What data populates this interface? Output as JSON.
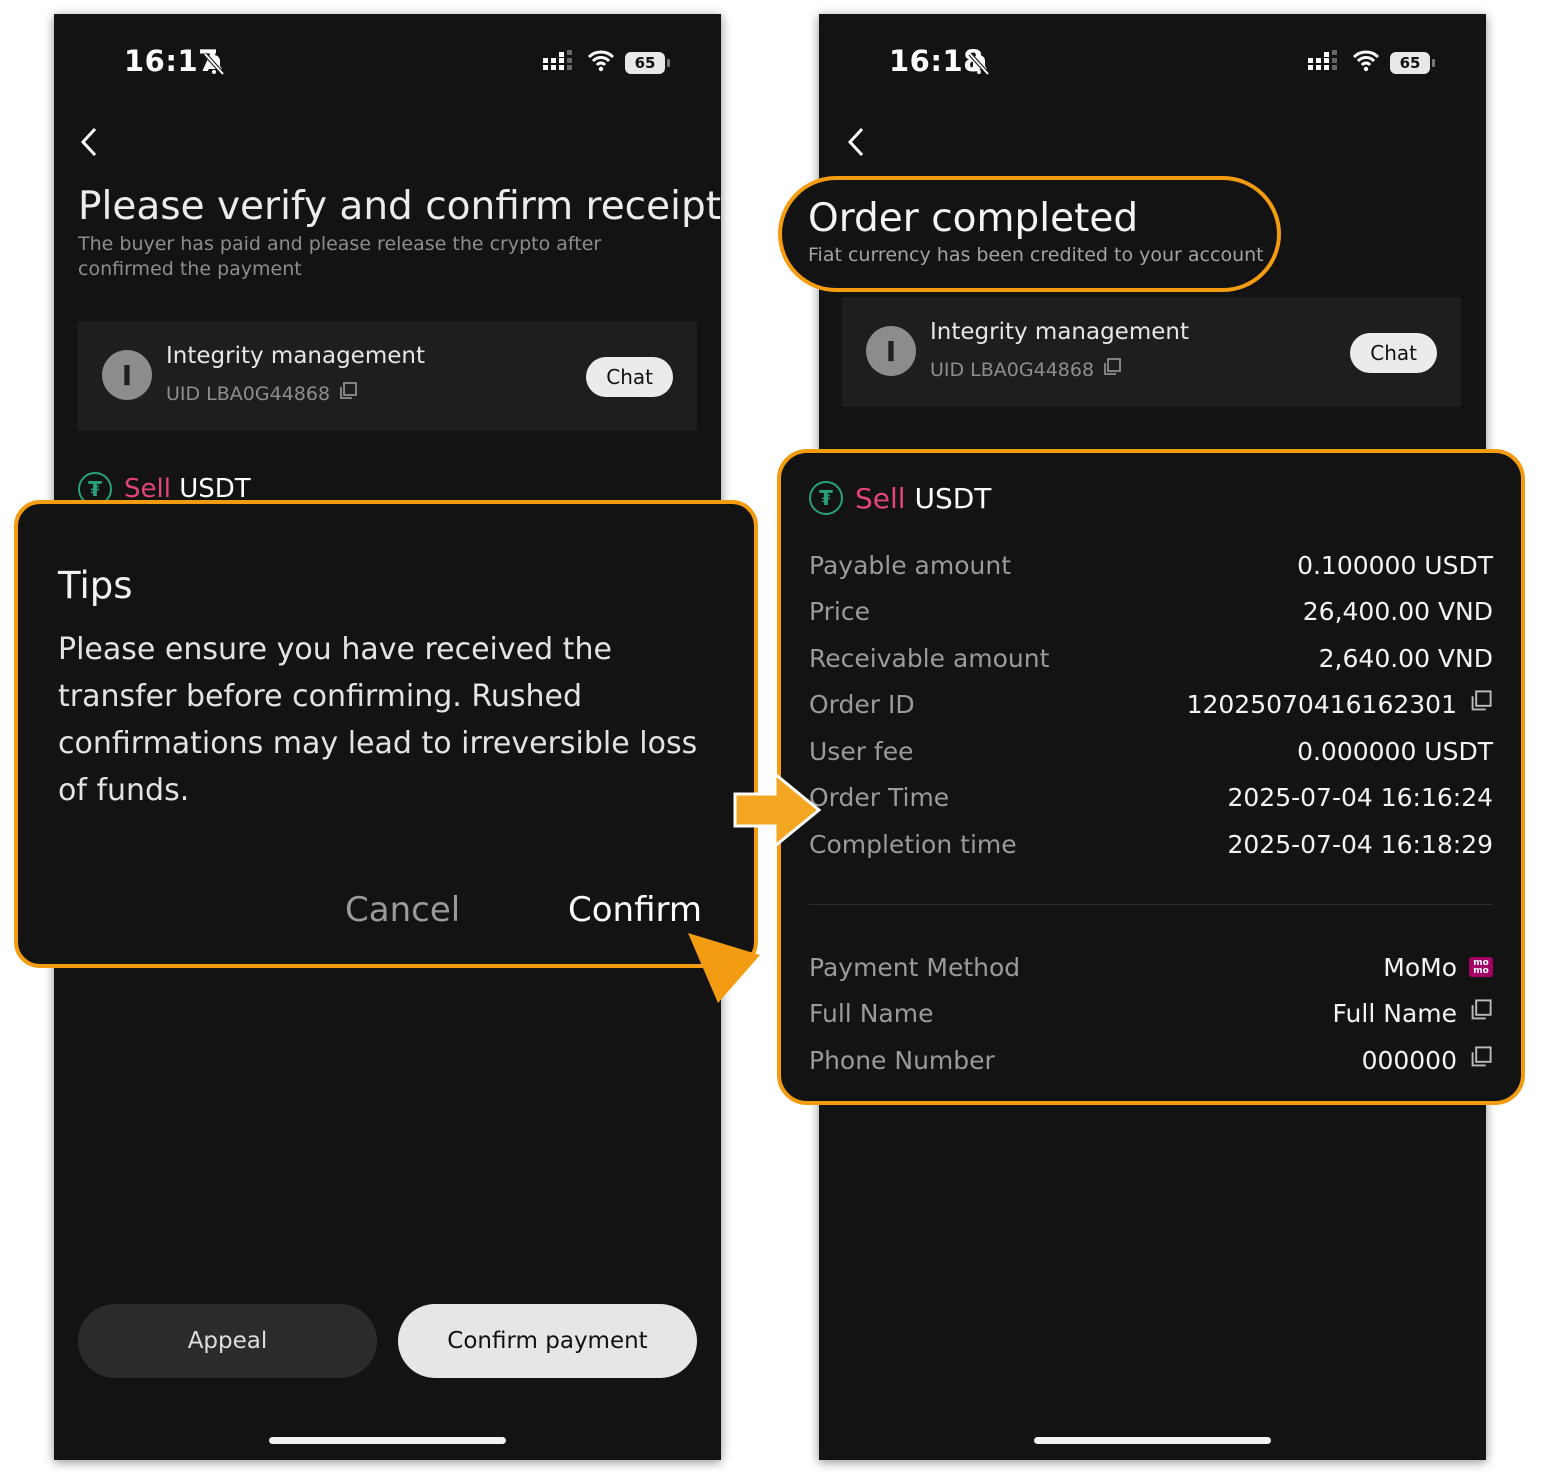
{
  "left_screen": {
    "status": {
      "time": "16:17",
      "battery": "65"
    },
    "title": "Please verify and confirm receipt",
    "subtitle": "The buyer has paid and please release the crypto after confirmed the payment",
    "merchant": {
      "avatar_letter": "I",
      "name": "Integrity management",
      "uid": "UID LBA0G44868",
      "chat_label": "Chat"
    },
    "sell_label": "Sell",
    "asset": "USDT",
    "appeal_label": "Appeal",
    "confirm_payment_label": "Confirm payment"
  },
  "tips_dialog": {
    "title": "Tips",
    "message": "Please ensure you have received the transfer before confirming. Rushed confirmations may lead to irreversible loss of funds.",
    "cancel_label": "Cancel",
    "confirm_label": "Confirm"
  },
  "right_screen": {
    "status": {
      "time": "16:18",
      "battery": "65"
    },
    "title": "Order completed",
    "subtitle": "Fiat currency has been credited to your account",
    "merchant": {
      "avatar_letter": "I",
      "name": "Integrity management",
      "uid": "UID LBA0G44868",
      "chat_label": "Chat"
    },
    "sell_label": "Sell",
    "asset": "USDT",
    "details": [
      {
        "label": "Payable amount",
        "value": "0.100000 USDT"
      },
      {
        "label": "Price",
        "value": "26,400.00 VND"
      },
      {
        "label": "Receivable amount",
        "value": "2,640.00 VND"
      },
      {
        "label": "Order ID",
        "value": "12025070416162301"
      },
      {
        "label": "User fee",
        "value": "0.000000 USDT"
      },
      {
        "label": "Order Time",
        "value": "2025-07-04 16:16:24"
      },
      {
        "label": "Completion time",
        "value": "2025-07-04 16:18:29"
      }
    ],
    "payment": [
      {
        "label": "Payment Method",
        "value": "MoMo"
      },
      {
        "label": "Full Name",
        "value": "Full Name"
      },
      {
        "label": "Phone Number",
        "value": "000000"
      }
    ],
    "momo_logo_text": "mo mo"
  },
  "colors": {
    "highlight": "#f39c12",
    "sell": "#e0457a",
    "tether": "#27a17c",
    "background": "#131313"
  }
}
